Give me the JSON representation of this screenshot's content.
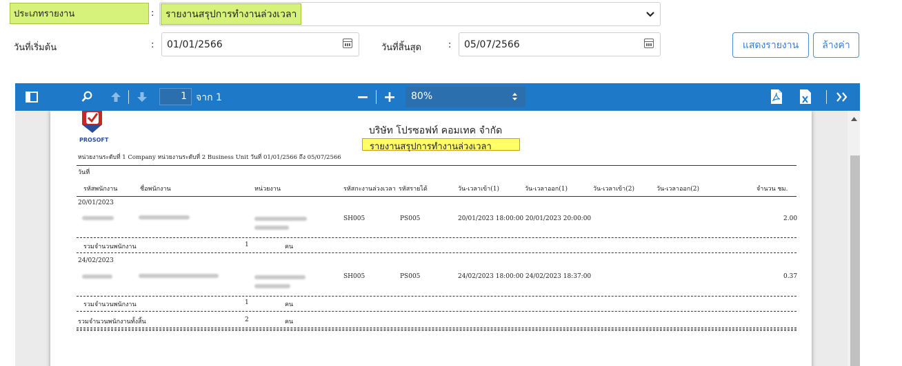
{
  "form": {
    "report_type_label": "ประเภทรายงาน",
    "colon": ":",
    "report_type_value": "รายงานสรุปการทำงานล่วงเวลา",
    "start_date_label": "วันที่เริ่มต้น",
    "start_date_value": "01/01/2566",
    "end_date_label": "วันที่สิ้นสุด",
    "end_date_value": "05/07/2566",
    "show_report_button": "แสดงรายงาน",
    "clear_button": "ล้างค่า"
  },
  "toolbar": {
    "page_current": "1",
    "page_of": "จาก 1",
    "zoom": "80%",
    "icons": [
      "sidebar-toggle-icon",
      "search-icon",
      "arrow-up-icon",
      "arrow-down-icon",
      "zoom-out-icon",
      "zoom-in-icon",
      "pdf-export-icon",
      "excel-export-icon",
      "more-icon"
    ]
  },
  "report": {
    "logo_text": "PROSOFT",
    "company": "บริษัท โปรซอฟท์ คอมเทค จำกัด",
    "title": "รายงานสรุปการทำงานล่วงเวลา",
    "filter_line": "หน่วยงานระดับที่ 1 Company หน่วยงานระดับที่ 2 Business Unit วันที่ 01/01/2566 ถึง 05/07/2566",
    "date_header": "วันที่",
    "columns": [
      "รหัสพนักงาน",
      "ชื่อพนักงาน",
      "หน่วยงาน",
      "รหัสกะงานล่วงเวลา",
      "รหัสรายได้",
      "วัน-เวลาเข้า(1)",
      "วัน-เวลาออก(1)",
      "วัน-เวลาเข้า(2)",
      "วัน-เวลาออก(2)",
      "จำนวน ชม."
    ],
    "groups": [
      {
        "date": "20/01/2023",
        "shift": "SH005",
        "income": "PS005",
        "in1": "20/01/2023 18:00:00",
        "out1": "20/01/2023 20:00:00",
        "hours": "2.00",
        "subtotal_label": "รวมจำนวนพนักงาน",
        "subtotal_count": "1",
        "unit": "คน"
      },
      {
        "date": "24/02/2023",
        "shift": "SH005",
        "income": "PS005",
        "in1": "24/02/2023 18:00:00",
        "out1": "24/02/2023 18:37:00",
        "hours": "0.37",
        "subtotal_label": "รวมจำนวนพนักงาน",
        "subtotal_count": "1",
        "unit": "คน"
      }
    ],
    "grand_total_label": "รวมจำนวนพนักงานทั้งสิ้น",
    "grand_total_count": "2",
    "grand_total_unit": "คน"
  },
  "colors": {
    "toolbar": "#1e7ac8",
    "highlight": "#d6f27a",
    "accent": "#2f7ed8"
  }
}
